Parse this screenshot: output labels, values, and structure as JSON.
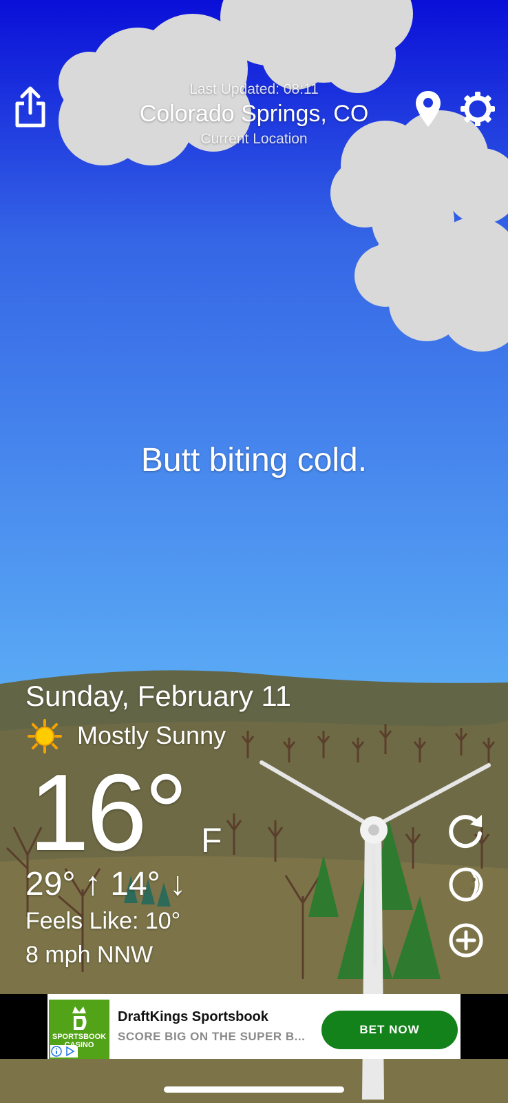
{
  "header": {
    "last_updated": "Last Updated: 08:11",
    "city": "Colorado Springs, CO",
    "location_label": "Current Location"
  },
  "tagline": "Butt biting cold.",
  "weather": {
    "date": "Sunday, February 11",
    "condition": "Mostly Sunny",
    "condition_icon": "sun-icon",
    "temperature": "16°",
    "unit": "F",
    "high_low": "29° ↑  14° ↓",
    "feels_like": "Feels Like: 10°",
    "wind": "8 mph NNW"
  },
  "ad": {
    "logo_text_1": "SPORTSBOOK",
    "logo_text_2": "CASINO",
    "title": "DraftKings Sportsbook",
    "subtitle": "SCORE BIG ON THE SUPER B...",
    "cta": "BET NOW"
  },
  "colors": {
    "sky_top": "#0a0fd8",
    "sky_bottom": "#5aaaf5",
    "hills": "#6e6a45",
    "ad_cta": "#14821a",
    "ad_logo": "#53a318"
  }
}
